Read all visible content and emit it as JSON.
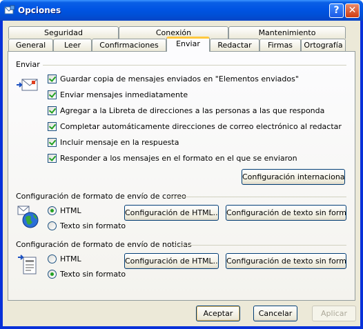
{
  "window": {
    "title": "Opciones",
    "help_label": "?",
    "close_label": "✕"
  },
  "tabs_row1": [
    {
      "label": "Seguridad"
    },
    {
      "label": "Conexión"
    },
    {
      "label": "Mantenimiento"
    }
  ],
  "tabs_row2": [
    {
      "label": "General"
    },
    {
      "label": "Leer"
    },
    {
      "label": "Confirmaciones"
    },
    {
      "label": "Enviar",
      "active": true
    },
    {
      "label": "Redactar"
    },
    {
      "label": "Firmas"
    },
    {
      "label": "Ortografía"
    }
  ],
  "enviar": {
    "title": "Enviar",
    "options": [
      {
        "label": "Guardar copia de mensajes enviados en \"Elementos enviados\"",
        "checked": true
      },
      {
        "label": "Enviar mensajes inmediatamente",
        "checked": true
      },
      {
        "label": "Agregar a la Libreta de direcciones a las personas a las que responda",
        "checked": true
      },
      {
        "label": "Completar automáticamente direcciones de correo electrónico al redactar",
        "checked": true
      },
      {
        "label": "Incluir mensaje en la respuesta",
        "checked": true
      },
      {
        "label": "Responder a los mensajes en el formato en el que se enviaron",
        "checked": true
      }
    ],
    "intl_button": "Configuración internacional..."
  },
  "mail_format": {
    "title": "Configuración de formato de envío de correo",
    "html_label": "HTML",
    "plain_label": "Texto sin formato",
    "selected": "HTML",
    "html_settings_button": "Configuración de HTML...",
    "plain_settings_button": "Configuración de texto sin formato..."
  },
  "news_format": {
    "title": "Configuración de formato de envío de noticias",
    "html_label": "HTML",
    "plain_label": "Texto sin formato",
    "selected": "Texto sin formato",
    "html_settings_button": "Configuración de HTML...",
    "plain_settings_button": "Configuración de texto sin formato..."
  },
  "footer": {
    "ok_label": "Aceptar",
    "cancel_label": "Cancelar",
    "apply_label": "Aplicar"
  },
  "colors": {
    "titlebar": "#0054e3",
    "dialog_bg": "#ece9d8",
    "active_tab_accent": "#ffc83c",
    "check_green": "#21a121"
  }
}
